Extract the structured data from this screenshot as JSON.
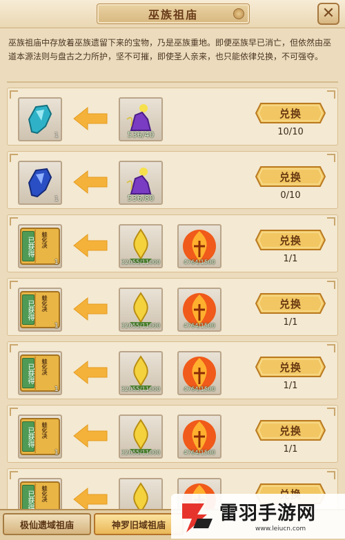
{
  "header": {
    "title": "巫族祖庙",
    "close_symbol": "✕"
  },
  "description": "巫族祖庙中存放着巫族遗留下来的宝物，乃是巫族重地。即便巫族早已消亡，但依然由巫道本源法则与盘古之力所护，坚不可摧，即使圣人亲来，也只能依律兑换，不可强夺。",
  "exchange_label": "兑换",
  "rows": [
    {
      "reward_icon": "teal-crystal-icon",
      "reward_qty": "1",
      "obtained": "",
      "book_title": "",
      "cost1_icon": "purple-spirit-icon",
      "cost1_text": "536/40",
      "cost2_icon": "",
      "cost2_text": "",
      "limit": "10/10"
    },
    {
      "reward_icon": "blue-crystal-icon",
      "reward_qty": "1",
      "obtained": "",
      "book_title": "",
      "cost1_icon": "purple-spirit-icon",
      "cost1_text": "536/80",
      "cost2_icon": "",
      "cost2_text": "",
      "limit": "0/10"
    },
    {
      "reward_icon": "skill-book-icon",
      "reward_qty": "1",
      "obtained": "已获得",
      "book_title": "蛙化决",
      "cost1_icon": "golden-soul-icon",
      "cost1_text": "32055/11000",
      "cost2_icon": "fire-essence-icon",
      "cost2_text": "4764/1500",
      "limit": "1/1"
    },
    {
      "reward_icon": "skill-book-icon",
      "reward_qty": "1",
      "obtained": "已获得",
      "book_title": "蛙化决",
      "cost1_icon": "golden-soul-icon",
      "cost1_text": "32055/11000",
      "cost2_icon": "fire-essence-icon",
      "cost2_text": "4764/1500",
      "limit": "1/1"
    },
    {
      "reward_icon": "skill-book-icon",
      "reward_qty": "1",
      "obtained": "已获得",
      "book_title": "蛙化决",
      "cost1_icon": "golden-soul-icon",
      "cost1_text": "32055/11000",
      "cost2_icon": "fire-essence-icon",
      "cost2_text": "4764/1500",
      "limit": "1/1"
    },
    {
      "reward_icon": "skill-book-icon",
      "reward_qty": "1",
      "obtained": "已获得",
      "book_title": "蛙化决",
      "cost1_icon": "golden-soul-icon",
      "cost1_text": "32055/11000",
      "cost2_icon": "fire-essence-icon",
      "cost2_text": "4764/1500",
      "limit": "1/1"
    },
    {
      "reward_icon": "skill-book-icon",
      "reward_qty": "1",
      "obtained": "已获得",
      "book_title": "蛙化决",
      "cost1_icon": "golden-soul-icon",
      "cost1_text": "",
      "cost2_icon": "fire-essence-icon",
      "cost2_text": "",
      "limit": ""
    }
  ],
  "tabs": [
    {
      "label": "极仙遗域祖庙",
      "active": false
    },
    {
      "label": "神罗旧域祖庙",
      "active": true
    }
  ],
  "watermark": {
    "title": "雷羽手游网",
    "url": "www.leiucn.com"
  },
  "colors": {
    "background": "#ecdcbd",
    "button_gold": "#f2c763",
    "obtained_green": "#4f9a55",
    "arrow_orange": "#f5b23a"
  }
}
